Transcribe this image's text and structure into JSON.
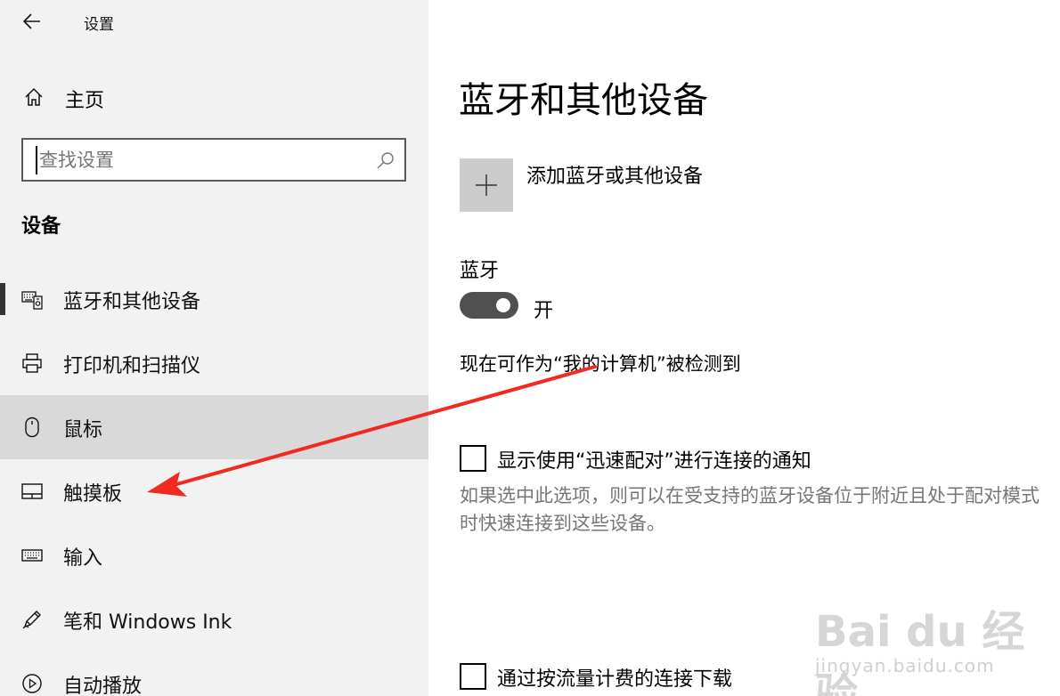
{
  "window": {
    "title": "设置"
  },
  "sidebar": {
    "home_label": "主页",
    "search_placeholder": "查找设置",
    "section_title": "设备",
    "items": [
      {
        "label": "蓝牙和其他设备",
        "icon": "bluetooth-devices-icon",
        "selected": true
      },
      {
        "label": "打印机和扫描仪",
        "icon": "printer-icon"
      },
      {
        "label": "鼠标",
        "icon": "mouse-icon",
        "hovered": true
      },
      {
        "label": "触摸板",
        "icon": "touchpad-icon"
      },
      {
        "label": "输入",
        "icon": "keyboard-icon"
      },
      {
        "label": "笔和 Windows Ink",
        "icon": "pen-icon"
      },
      {
        "label": "自动播放",
        "icon": "autoplay-icon"
      }
    ]
  },
  "main": {
    "page_title": "蓝牙和其他设备",
    "add_device_label": "添加蓝牙或其他设备",
    "bluetooth_label": "蓝牙",
    "bluetooth_state": "开",
    "bluetooth_on": true,
    "discoverable_text": "现在可作为“我的计算机”被检测到",
    "swift_pair_label": "显示使用“迅速配对”进行连接的通知",
    "swift_pair_checked": false,
    "swift_pair_desc": "如果选中此选项，则可以在受支持的蓝牙设备位于附近且处于配对模式时快速连接到这些设备。",
    "metered_label": "通过按流量计费的连接下载",
    "metered_checked": false
  },
  "annotation": {
    "color": "#f02a1e"
  },
  "watermark": {
    "logo": "Bai du 经验",
    "url": "jingyan.baidu.com"
  },
  "colors": {
    "sidebar_bg": "#f2f2f2",
    "hover_bg": "#d9d9d9",
    "toggle_on": "#505050",
    "add_btn_bg": "#cccccc",
    "desc_gray": "#767676"
  }
}
